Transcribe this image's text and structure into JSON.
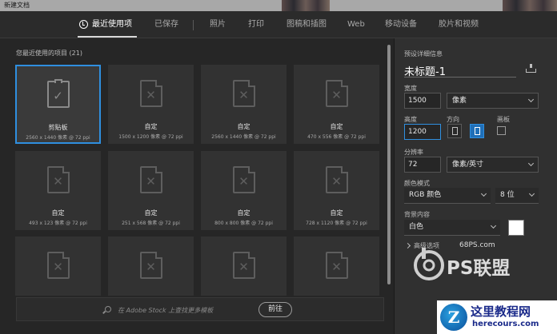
{
  "window": {
    "title": "新建文档"
  },
  "tabs": [
    {
      "label": "最近使用项",
      "active": true
    },
    {
      "label": "已保存",
      "active": false
    },
    {
      "label": "照片",
      "active": false
    },
    {
      "label": "打印",
      "active": false
    },
    {
      "label": "图稿和插图",
      "active": false
    },
    {
      "label": "Web",
      "active": false
    },
    {
      "label": "移动设备",
      "active": false
    },
    {
      "label": "胶片和视频",
      "active": false
    }
  ],
  "recent": {
    "title": "您最近使用的项目",
    "count": "(21)",
    "items": [
      {
        "name": "剪贴板",
        "dims": "2560 x 1440 像素 @ 72 ppi",
        "icon": "clipboard-check-icon",
        "selected": true
      },
      {
        "name": "自定",
        "dims": "1500 x 1200 像素 @ 72 ppi",
        "icon": "document-custom-icon"
      },
      {
        "name": "自定",
        "dims": "2560 x 1440 像素 @ 72 ppi",
        "icon": "document-custom-icon"
      },
      {
        "name": "自定",
        "dims": "470 x 556 像素 @ 72 ppi",
        "icon": "document-custom-icon"
      },
      {
        "name": "自定",
        "dims": "493 x 123 像素 @ 72 ppi",
        "icon": "document-custom-icon"
      },
      {
        "name": "自定",
        "dims": "251 x 568 像素 @ 72 ppi",
        "icon": "document-custom-icon"
      },
      {
        "name": "自定",
        "dims": "800 x 800 像素 @ 72 ppi",
        "icon": "document-custom-icon"
      },
      {
        "name": "自定",
        "dims": "728 x 1120 像素 @ 72 ppi",
        "icon": "document-custom-icon"
      },
      {
        "name": "",
        "dims": "",
        "icon": "document-custom-icon"
      },
      {
        "name": "",
        "dims": "",
        "icon": "document-custom-icon"
      },
      {
        "name": "",
        "dims": "",
        "icon": "document-custom-icon"
      },
      {
        "name": "",
        "dims": "",
        "icon": "document-custom-icon"
      }
    ]
  },
  "search": {
    "placeholder": "在 Adobe Stock 上查找更多模板",
    "go_label": "前往"
  },
  "preset": {
    "header": "预设详细信息",
    "doc_name": "未标题-1",
    "width_label": "宽度",
    "width_value": "1500",
    "width_unit": "像素",
    "height_label": "高度",
    "height_value": "1200",
    "orientation_label": "方向",
    "artboard_label": "画板",
    "resolution_label": "分辨率",
    "resolution_value": "72",
    "resolution_unit": "像素/英寸",
    "color_mode_label": "颜色模式",
    "color_mode_value": "RGB 颜色",
    "bit_depth_value": "8 位",
    "background_label": "背景内容",
    "background_value": "白色",
    "background_color": "#ffffff",
    "advanced_label": "高级选项"
  },
  "watermark": {
    "site": "68PS.com",
    "brand": "PS联盟"
  },
  "footer_logo": {
    "mark": "Z",
    "name": "这里教程网",
    "url": "herecours.com"
  },
  "colors": {
    "accent": "#2f8fdf",
    "panel": "#303030",
    "background": "#262626"
  }
}
